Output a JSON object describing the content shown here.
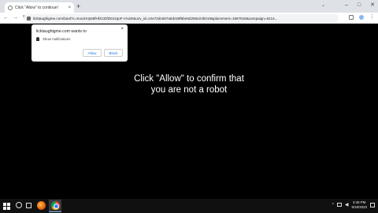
{
  "browser": {
    "tab_title": "Click \"Allow\" to continue!",
    "tab_close": "×",
    "new_tab": "+",
    "tab_menu": "⌄",
    "window_controls": [
      "–",
      "□",
      "✕"
    ],
    "url": "licktaughigme.com/land?c=KvuSXIy66fHf4CDfZKtrJqoF-c%2D&uzv_id=10x72dc667a6dc59f5be5d256e24b018&placement=1667818&campaign=6214...",
    "nav": {
      "back": "←",
      "forward": "→",
      "reload": "↻"
    },
    "menu_glyph": "⋮"
  },
  "popup": {
    "site_text": "licktaughigme.com wants to",
    "close": "×",
    "permission_label": "Show notifications",
    "allow_label": "Allow",
    "block_label": "Block"
  },
  "page": {
    "message_line1": "Click \"Allow\" to confirm that",
    "message_line2": "you are not a robot"
  },
  "taskbar": {
    "tray_caret": "^",
    "volume_glyph": "◀",
    "time": "3:45 PM",
    "date": "5/18/2023"
  },
  "colors": {
    "page_bg": "#000000",
    "link_blue": "#1a73e8",
    "tab_strip": "#dee1e6",
    "taskbar": "#101010"
  }
}
